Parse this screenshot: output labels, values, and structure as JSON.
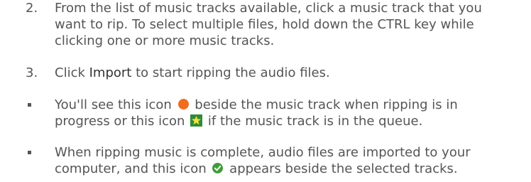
{
  "steps": [
    {
      "number": "2.",
      "lines": [
        "From the list of music tracks available, click a music track that you",
        "want to rip. To select multiple files, hold down the CTRL key while",
        "clicking one or more music tracks."
      ]
    },
    {
      "number": "3.",
      "before": "Click ",
      "emphasis": "Import",
      "after": " to start ripping the audio files."
    }
  ],
  "bullets": [
    {
      "line1_before": "You'll see this icon ",
      "line1_after": " beside the music track when ripping is in",
      "line2_before": "progress or this icon ",
      "line2_after": " if the music track is in the queue.",
      "icons": [
        "ripping-in-progress-icon",
        "queued-star-icon"
      ]
    },
    {
      "line1": "When ripping music is complete, audio files are imported to your",
      "line2_before": "computer, and this icon ",
      "line2_after": " appears beside the selected tracks.",
      "icons": [
        "ripped-check-icon"
      ]
    }
  ],
  "colors": {
    "text": "#555555",
    "orange_icon": "#f36c1d",
    "star_icon_bg": "#2e8b3a",
    "star": "#f2e23a",
    "check_icon": "#3f9e37"
  }
}
